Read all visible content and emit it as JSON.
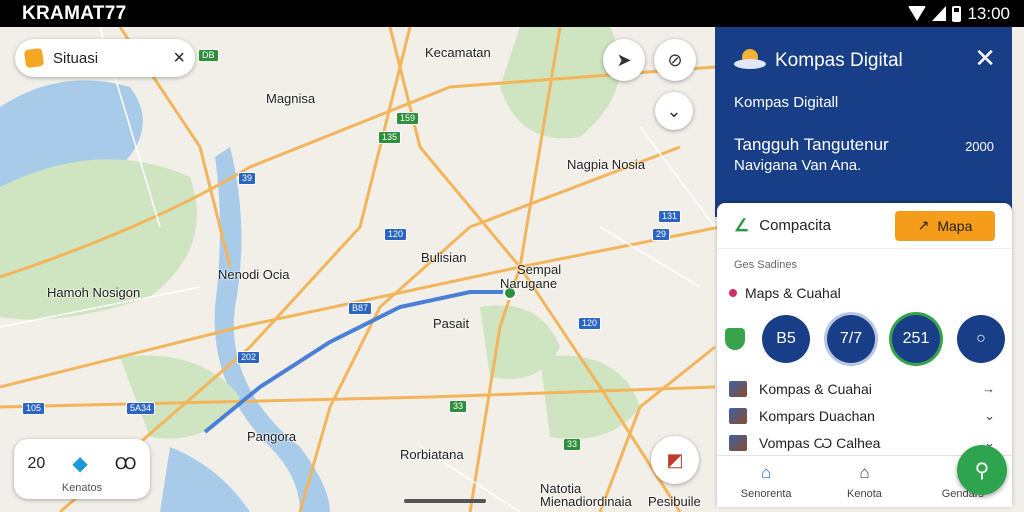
{
  "status_bar": {
    "title": "KRAMAT77",
    "time": "13:00"
  },
  "map": {
    "labels": [
      "Kecamatan",
      "Magnisa",
      "Nagpia Nosia",
      "Nenodi Ocia",
      "Hamoh Nosigon",
      "Bulisian",
      "Sempal",
      "Narugane",
      "Pasait",
      "Pangora",
      "Rorbiatana",
      "Natotia",
      "Mienadiordinaia",
      "Pesibuile"
    ],
    "shields": [
      "DB",
      "159",
      "135",
      "39",
      "131",
      "120",
      "29",
      "B87",
      "120",
      "202",
      "105",
      "5A34",
      "33",
      "33"
    ],
    "colors": {
      "road": "#f3b55b",
      "water": "#a8cbe9",
      "park": "#cfe4c0",
      "route": "#4a7fd6"
    }
  },
  "search_chip": {
    "label": "Situasi",
    "icon": "tag-icon"
  },
  "bottom_card": {
    "item1": "20",
    "item3": "Ꝏ",
    "caption": "Kenatos"
  },
  "panel": {
    "app_title": "Kompas Digital",
    "subtitle": "Kompas Digitall",
    "heading": "Tangguh Tangutenur",
    "heading_extra": "2000",
    "subtitle2": "Navigana Van Ana.",
    "sheet_title": "Compacita",
    "map_button": "Mapa",
    "section_label": "Ges Sadines",
    "maps_row": "Maps & Cuahal",
    "circles": [
      "B5",
      "7/7",
      "251",
      "○"
    ],
    "list": [
      {
        "label": "Kompas & Cuahai",
        "chevron": "→"
      },
      {
        "label": "Kompars Duachan",
        "chevron": "⌄"
      },
      {
        "label": "Vompas Ѡ Calhea",
        "chevron": "⌄"
      }
    ],
    "tabs": [
      "Senorenta",
      "Kenota",
      "Gendars"
    ]
  }
}
